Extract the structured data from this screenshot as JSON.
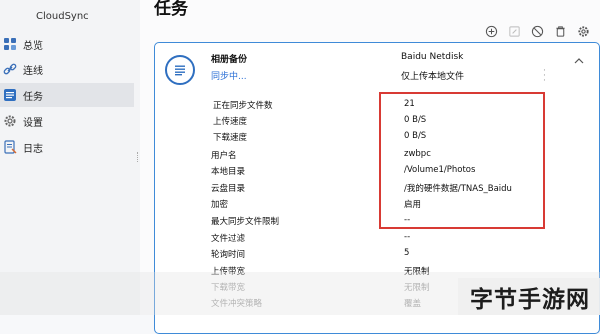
{
  "app": {
    "title": "CloudSync"
  },
  "sidebar": {
    "items": [
      {
        "label": "总览",
        "icon": "grid-icon"
      },
      {
        "label": "连线",
        "icon": "link-icon"
      },
      {
        "label": "任务",
        "icon": "task-list-icon",
        "active": true
      },
      {
        "label": "设置",
        "icon": "gear-icon"
      },
      {
        "label": "日志",
        "icon": "log-icon"
      }
    ]
  },
  "page": {
    "title": "任务"
  },
  "toolbar": {
    "icons": [
      "add-icon",
      "edit-icon",
      "pause-icon",
      "delete-icon",
      "settings-icon"
    ]
  },
  "task": {
    "name": "相册备份",
    "status": "同步中...",
    "provider": "Baidu Netdisk",
    "direction": "仅上传本地文件",
    "details": [
      {
        "label": "正在同步文件数",
        "value": "21"
      },
      {
        "label": "上传速度",
        "value": "0 B/S"
      },
      {
        "label": "下载速度",
        "value": "0 B/S"
      },
      {
        "label": "用户名",
        "value": "zwbpc"
      },
      {
        "label": "本地目录",
        "value": "/Volume1/Photos"
      },
      {
        "label": "云盘目录",
        "value": "/我的硬件数据/TNAS_Baidu"
      },
      {
        "label": "加密",
        "value": "启用"
      },
      {
        "label": "最大同步文件限制",
        "value": "--"
      },
      {
        "label": "文件过滤",
        "value": "--"
      },
      {
        "label": "轮询时间",
        "value": "5"
      },
      {
        "label": "上传带宽",
        "value": "无限制"
      },
      {
        "label": "下载带宽",
        "value": "无限制"
      },
      {
        "label": "文件冲突策略",
        "value": "覆盖"
      }
    ]
  },
  "watermark": {
    "text": "字节手游网"
  },
  "colors": {
    "accent": "#2b6fd6",
    "highlight": "#d83a34",
    "card_border": "#3f8bd8"
  }
}
